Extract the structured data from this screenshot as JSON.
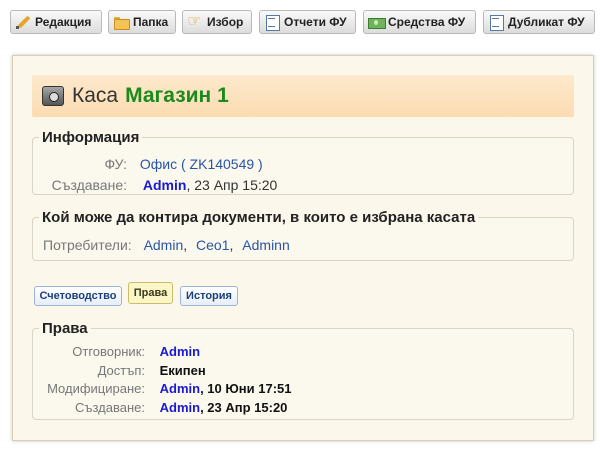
{
  "toolbar": {
    "buttons": [
      {
        "label": "Редакция",
        "icon": "pencil-icon"
      },
      {
        "label": "Папка",
        "icon": "folder-icon"
      },
      {
        "label": "Избор",
        "icon": "pointing-hand-icon"
      },
      {
        "label": "Отчети ФУ",
        "icon": "report-icon"
      },
      {
        "label": "Средства ФУ",
        "icon": "money-icon"
      },
      {
        "label": "Дубликат ФУ",
        "icon": "duplicate-icon"
      }
    ]
  },
  "header": {
    "word": "Каса",
    "name": "Магазин 1"
  },
  "info": {
    "legend": "Информация",
    "fu_label": "ФУ:",
    "fu_value": "Офис ( ZK140549 )",
    "created_label": "Създаване:",
    "created_user": "Admin",
    "created_date": ", 23 Апр 15:20"
  },
  "access": {
    "legend": "Кой може да контира документи, в които е избрана касата",
    "users_label": "Потребители:",
    "users": [
      "Admin",
      "Ceo1",
      "Adminn"
    ],
    "separator": ","
  },
  "tabs": [
    {
      "label": "Счетоводство",
      "active": false
    },
    {
      "label": "Права",
      "active": true
    },
    {
      "label": "История",
      "active": false
    }
  ],
  "rights": {
    "legend": "Права",
    "owner_label": "Отговорник:",
    "owner_value": "Admin",
    "access_label": "Достъп:",
    "access_value": "Екипен",
    "modified_label": "Модифициране:",
    "modified_user": "Admin",
    "modified_date": ", 10 Юни 17:51",
    "created_label": "Създаване:",
    "created_user": "Admin",
    "created_date": ", 23 Апр 15:20"
  },
  "colors": {
    "title_name": "#1c8a1c",
    "link": "#2a55a6",
    "bold_link": "#1a1ad0",
    "panel_bg": "#fbf7ea",
    "titlebar_bg": "#fbdcb2"
  }
}
